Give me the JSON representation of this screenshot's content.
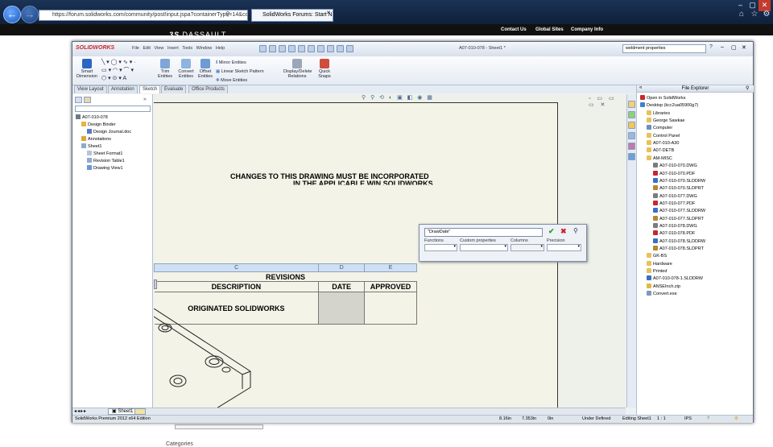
{
  "browser": {
    "url": "https://forum.solidworks.com/community/post!input.jspa?containerType=14&co",
    "tab_title": "SolidWorks Forums: Start N...",
    "header_links": [
      "Contact Us",
      "Global Sites",
      "Company Info"
    ],
    "brand": "DASSAULT"
  },
  "solidworks": {
    "logo": "SOLIDWORKS",
    "menu": [
      "File",
      "Edit",
      "View",
      "Insert",
      "Tools",
      "Window",
      "Help"
    ],
    "title": "A07-010-078 - Sheet1 *",
    "search_value": "weldment properties",
    "ribbon": {
      "smart_dimension": "Smart Dimension",
      "trim_entities": "Trim Entities",
      "convert_entities": "Convert Entities",
      "offset_entities": "Offset Entities",
      "mirror_entities": "Mirror Entities",
      "linear_sketch_pattern": "Linear Sketch Pattern",
      "move_entities": "Move Entities",
      "display_delete_relations": "Display/Delete Relations",
      "quick_snaps": "Quick Snaps"
    },
    "command_tabs": [
      "View Layout",
      "Annotation",
      "Sketch",
      "Evaluate",
      "Office Products"
    ],
    "feature_tree": [
      {
        "label": "A07-010-078",
        "indent": 0
      },
      {
        "label": "Design Binder",
        "indent": 1
      },
      {
        "label": "Design Journal.doc",
        "indent": 2
      },
      {
        "label": "Annotations",
        "indent": 1
      },
      {
        "label": "Sheet1",
        "indent": 1
      },
      {
        "label": "Sheet Format1",
        "indent": 2
      },
      {
        "label": "Revision Table1",
        "indent": 2
      },
      {
        "label": "Drawing View1",
        "indent": 2
      }
    ],
    "drawing": {
      "note_line1": "CHANGES TO THIS DRAWING MUST BE INCORPORATED",
      "note_line2": "IN THE APPLICABLE WIN SOLIDWORKS",
      "table_col_letters": [
        "C",
        "D",
        "E"
      ],
      "revisions_title": "REVISIONS",
      "headers": [
        "DESCRIPTION",
        "DATE",
        "APPROVED"
      ],
      "row_description": "ORIGINATED SOLIDWORKS"
    },
    "property_dialog": {
      "input_value": "\"DrawDate\"",
      "labels": [
        "Functions",
        "Custom properties",
        "Columns",
        "Precision"
      ]
    },
    "sheet_tab": "Sheet1",
    "status": {
      "edition": "SolidWorks Premium 2012 x64 Edition",
      "x": "8.16in",
      "y": "7.353in",
      "z": "0in",
      "state": "Under Defined",
      "editing": "Editing Sheet1",
      "scale": "1 : 1",
      "units": "IPS"
    },
    "file_explorer": {
      "title": "File Explorer",
      "items": [
        {
          "label": "Open in SolidWorks",
          "indent": 0,
          "type": "sw"
        },
        {
          "label": "Desktop (kcc2ua05900g7)",
          "indent": 0,
          "type": "desktop"
        },
        {
          "label": "Libraries",
          "indent": 1,
          "type": "folder"
        },
        {
          "label": "George Sawkae",
          "indent": 1,
          "type": "folder"
        },
        {
          "label": "Computer",
          "indent": 1,
          "type": "computer"
        },
        {
          "label": "Control Panel",
          "indent": 1,
          "type": "folder"
        },
        {
          "label": "A07-010-A30",
          "indent": 1,
          "type": "folder"
        },
        {
          "label": "A07-DETB",
          "indent": 1,
          "type": "folder"
        },
        {
          "label": "AM-MISC",
          "indent": 1,
          "type": "folder"
        },
        {
          "label": "A07-010-070.DWG",
          "indent": 2,
          "type": "dwg"
        },
        {
          "label": "A07-010-070.PDF",
          "indent": 2,
          "type": "pdf"
        },
        {
          "label": "A07-010-070.SLDDRW",
          "indent": 2,
          "type": "drw"
        },
        {
          "label": "A07-010-070.SLDPRT",
          "indent": 2,
          "type": "prt"
        },
        {
          "label": "A07-010-077.DWG",
          "indent": 2,
          "type": "dwg"
        },
        {
          "label": "A07-010-077.PDF",
          "indent": 2,
          "type": "pdf"
        },
        {
          "label": "A07-010-077.SLDDRW",
          "indent": 2,
          "type": "drw"
        },
        {
          "label": "A07-010-077.SLDPRT",
          "indent": 2,
          "type": "prt"
        },
        {
          "label": "A07-010-078.DWG",
          "indent": 2,
          "type": "dwg"
        },
        {
          "label": "A07-010-078.PDF",
          "indent": 2,
          "type": "pdf"
        },
        {
          "label": "A07-010-078.SLDDRW",
          "indent": 2,
          "type": "drw"
        },
        {
          "label": "A07-010-078.SLDPRT",
          "indent": 2,
          "type": "prt"
        },
        {
          "label": "GK-BS",
          "indent": 1,
          "type": "folder"
        },
        {
          "label": "Hardware",
          "indent": 1,
          "type": "folder"
        },
        {
          "label": "Printed",
          "indent": 1,
          "type": "folder"
        },
        {
          "label": "A07-010-078-1.SLDDRW",
          "indent": 1,
          "type": "drw"
        },
        {
          "label": "ANSEInch.zip",
          "indent": 1,
          "type": "zip"
        },
        {
          "label": "Convert.exe",
          "indent": 1,
          "type": "exe"
        }
      ]
    }
  },
  "page_below": {
    "categories": "Categories"
  },
  "colors": {
    "accent": "#cfe0f3",
    "selection": "#316ac5",
    "pdf": "#c8262b",
    "folder": "#e8c15a"
  }
}
